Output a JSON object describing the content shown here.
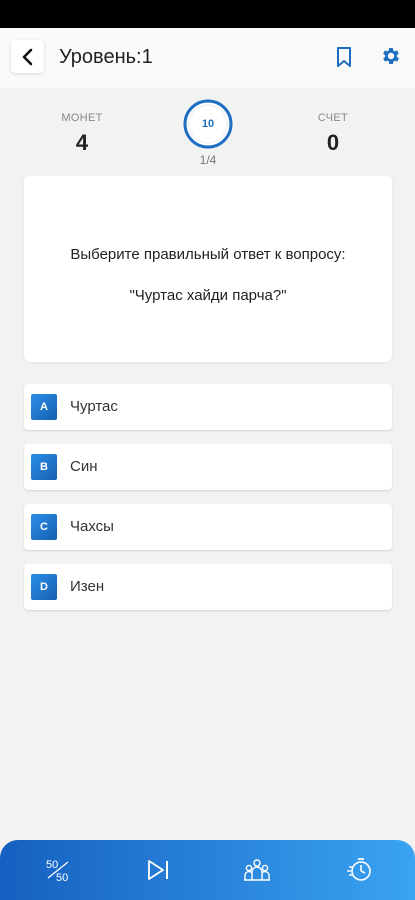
{
  "app_bar": {
    "title": "Уровень:1",
    "back_icon": "chevron-left-icon",
    "bookmark_icon": "bookmark-icon",
    "settings_icon": "gear-icon"
  },
  "stats": {
    "coins_label": "МОНЕТ",
    "coins_value": "4",
    "score_label": "СЧЕТ",
    "score_value": "0",
    "timer_value": "10",
    "progress": "1/4"
  },
  "question": {
    "prompt": "Выберите правильный ответ к вопросу:",
    "text": "\"Чуртас хайди парча?\""
  },
  "answers": [
    {
      "letter": "A",
      "text": "Чуртас"
    },
    {
      "letter": "B",
      "text": "Син"
    },
    {
      "letter": "C",
      "text": "Чахсы"
    },
    {
      "letter": "D",
      "text": "Изен"
    }
  ],
  "bottom_nav": {
    "items": [
      "fifty-fifty-icon",
      "skip-icon",
      "audience-icon",
      "time-freeze-icon"
    ]
  },
  "colors": {
    "accent": "#1e6fc2",
    "nav_gradient_start": "#1560c0",
    "nav_gradient_end": "#3aa3f2"
  }
}
